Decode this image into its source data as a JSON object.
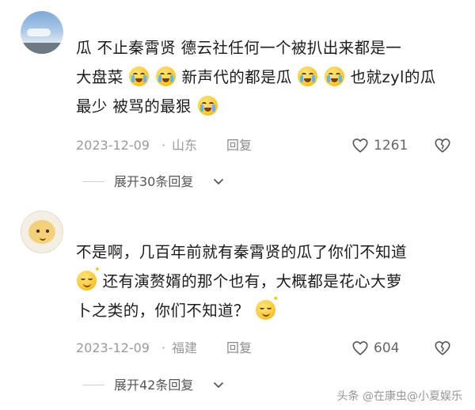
{
  "comments": [
    {
      "lines": [
        [
          "瓜  不止秦霄贤  德云社任何一个被扒出来都是一"
        ],
        [
          "大盘菜",
          "",
          "",
          "新声代的都是瓜",
          "",
          "",
          "也就zyl的瓜"
        ],
        [
          "最少   被骂的最狠",
          ""
        ]
      ],
      "date": "2023-12-09",
      "separator": "·",
      "location": "山东",
      "reply_label": "回复",
      "like_icon": "heart-icon",
      "like_count": "1261",
      "dislike_icon": "broken-heart-icon",
      "expand_label": "展开30条回复",
      "expand_icon": "chevron-down-icon"
    },
    {
      "lines": [
        [
          "不是啊，几百年前就有秦霄贤的瓜了你们不知道"
        ],
        [
          "",
          "还有演赘婿的那个也有，大概都是花心大萝"
        ],
        [
          "卜之类的，你们不知道？",
          ""
        ]
      ],
      "date": "2023-12-09",
      "separator": "·",
      "location": "福建",
      "reply_label": "回复",
      "like_icon": "heart-icon",
      "like_count": "604",
      "dislike_icon": "broken-heart-icon",
      "expand_label": "展开42条回复",
      "expand_icon": "chevron-down-icon"
    }
  ],
  "watermark": "头条 @在康虫@小夏娱乐"
}
